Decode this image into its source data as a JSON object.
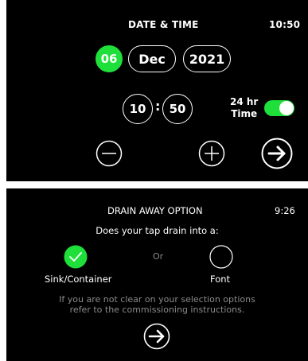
{
  "date_time": {
    "title": "DATE & TIME",
    "clock": "10:50",
    "day": "06",
    "month": "Dec",
    "year": "2021",
    "hour": "10",
    "separator": ":",
    "minute": "50",
    "toggle_label_line1": "24 hr",
    "toggle_label_line2": "Time",
    "toggle_on": true,
    "icons": [
      "minus-circle-icon",
      "plus-circle-icon",
      "arrow-right-circle-icon"
    ],
    "accent_color": "#1fe03a"
  },
  "drain": {
    "title": "DRAIN AWAY OPTION",
    "clock": "9:26",
    "question": "Does your tap drain into a:",
    "or_text": "Or",
    "option1_label": "Sink/Container",
    "option2_label": "Font",
    "help_line1": "If you are not clear on your selection options",
    "help_line2": "refer to the commissioning instructions.",
    "selected_option": "Sink/Container"
  }
}
